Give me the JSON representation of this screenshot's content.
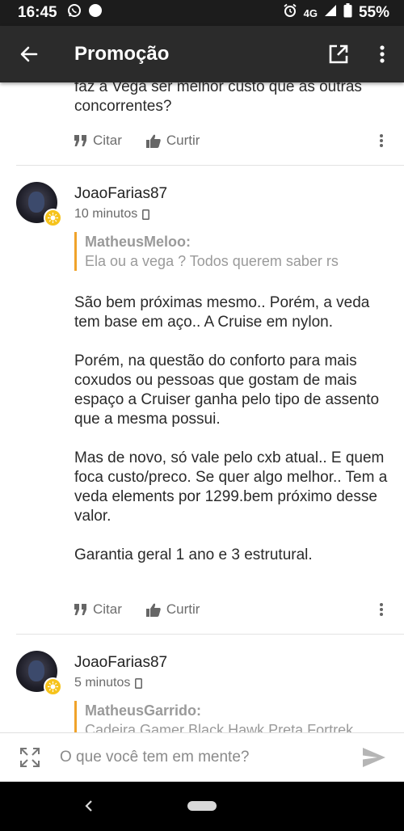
{
  "status_bar": {
    "time": "16:45",
    "network": "4G",
    "battery": "55%",
    "icons": [
      "whatsapp-icon",
      "circle-notification-icon",
      "alarm-icon",
      "signal-icon",
      "battery-icon"
    ]
  },
  "app_bar": {
    "title": "Promoção",
    "icons": [
      "back-arrow-icon",
      "open-external-icon",
      "more-vert-icon"
    ]
  },
  "previous_post": {
    "text": "faz a Vega ser melhor custo que as outras concorrentes?"
  },
  "actions": {
    "quote_label": "Citar",
    "like_label": "Curtir"
  },
  "posts": [
    {
      "username": "JoaoFarias87",
      "time": "10 minutos",
      "quote_user": "MatheusMeloo:",
      "quote_text": "Ela ou a vega ? Todos querem saber rs",
      "paragraphs": [
        "São bem próximas mesmo.. Porém, a veda tem base em aço.. A Cruise em nylon.",
        "Porém, na questão do conforto para mais coxudos ou pessoas que gostam de mais espaço a Cruiser ganha pelo tipo de assento que a mesma possui.",
        "Mas de novo, só vale pelo cxb atual.. E quem foca custo/preco. Se quer algo melhor.. Tem a veda elements por 1299.bem próximo desse valor.",
        "Garantia geral 1 ano e 3 estrutural."
      ]
    },
    {
      "username": "JoaoFarias87",
      "time": "5 minutos",
      "quote_user": "MatheusGarrido:",
      "quote_text": "Cadeira Gamer Black Hawk Preta Fortrek"
    }
  ],
  "composer": {
    "placeholder": "O que você tem em mente?"
  },
  "colors": {
    "app_bar": "#2b2b2b",
    "status_bar": "#1c1c1c",
    "quote_accent": "#f0a32a",
    "badge": "#f6c31b"
  }
}
